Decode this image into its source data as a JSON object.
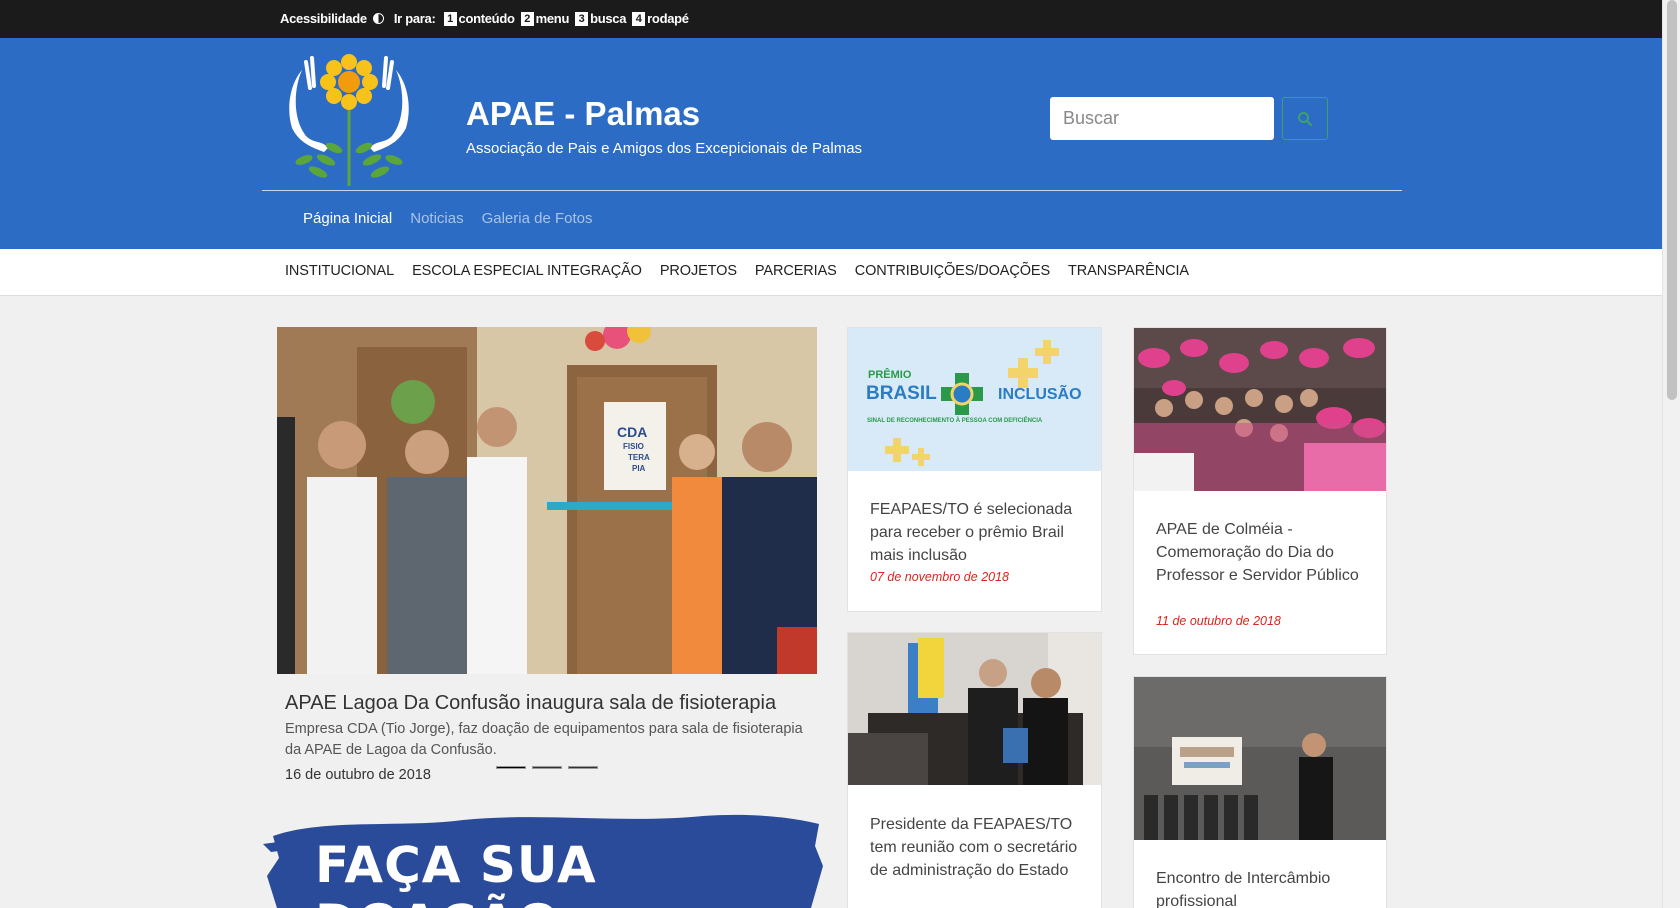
{
  "topbar": {
    "acessibilidade": "Acessibilidade",
    "ir_para": "Ir para:",
    "skips": [
      {
        "num": "1",
        "label": "conteúdo"
      },
      {
        "num": "2",
        "label": "menu"
      },
      {
        "num": "3",
        "label": "busca"
      },
      {
        "num": "4",
        "label": "rodapé"
      }
    ]
  },
  "header": {
    "title": "APAE - Palmas",
    "subtitle": "Associação de Pais e Amigos dos Excepicionais de Palmas",
    "search_placeholder": "Buscar",
    "subnav": [
      "Página Inicial",
      "Noticias",
      "Galeria de Fotos"
    ]
  },
  "mainnav": [
    "INSTITUCIONAL",
    "ESCOLA ESPECIAL INTEGRAÇÃO",
    "PROJETOS",
    "PARCERIAS",
    "CONTRIBUIÇÕES/DOAÇÕES",
    "TRANSPARÊNCIA"
  ],
  "featured": {
    "title": "APAE Lagoa Da Confusão inaugura sala de fisioterapia",
    "description": "Empresa CDA (Tio Jorge), faz doação de equipamentos para sala de fisioterapia da APAE de Lagoa da Confusão.",
    "date": "16 de outubro de 2018",
    "door_sign": [
      "CDA",
      "FISIO",
      "TERA",
      "PIA"
    ],
    "slides_total": 3,
    "slide_active": 1
  },
  "donate": {
    "text": "FAÇA SUA DOAÇÃO"
  },
  "cards": [
    {
      "title": "FEAPAES/TO é selecionada para receber o prêmio Brail mais inclusão",
      "date": "07 de novembro de 2018",
      "banner": {
        "premio": "PRÊMIO",
        "brasil": "BRASIL",
        "inclusao": "INCLUSÃO",
        "tagline": "SINAL DE RECONHECIMENTO À PESSOA COM DEFICIÊNCIA"
      }
    },
    {
      "title": "APAE de Colméia - Comemoração do Dia do Professor e Servidor Público",
      "date": "11 de outubro de 2018"
    },
    {
      "title": "Presidente da FEAPAES/TO tem reunião com o secretário de administração do Estado",
      "date": ""
    },
    {
      "title": "Encontro de Intercâmbio profissional",
      "date": ""
    }
  ],
  "colors": {
    "header_blue": "#2c6cc4",
    "topbar": "#1b1b1b",
    "date_red": "#d9261c",
    "search_green": "#3fa16a"
  }
}
